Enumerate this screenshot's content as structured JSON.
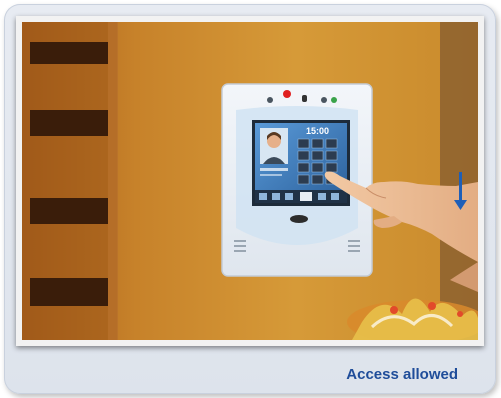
{
  "caption": "Access allowed",
  "terminal": {
    "time": "15:00",
    "keypad_digits": [
      "1",
      "2",
      "3",
      "4",
      "5",
      "6",
      "7",
      "8",
      "9",
      "*",
      "0",
      "#"
    ]
  },
  "colors": {
    "card_background": "#e1e6ee",
    "caption_text": "#1f4d9a",
    "wall": "#c98a2c",
    "screen": "#3b77b8",
    "indicator_arrow": "#1e5fb8"
  }
}
